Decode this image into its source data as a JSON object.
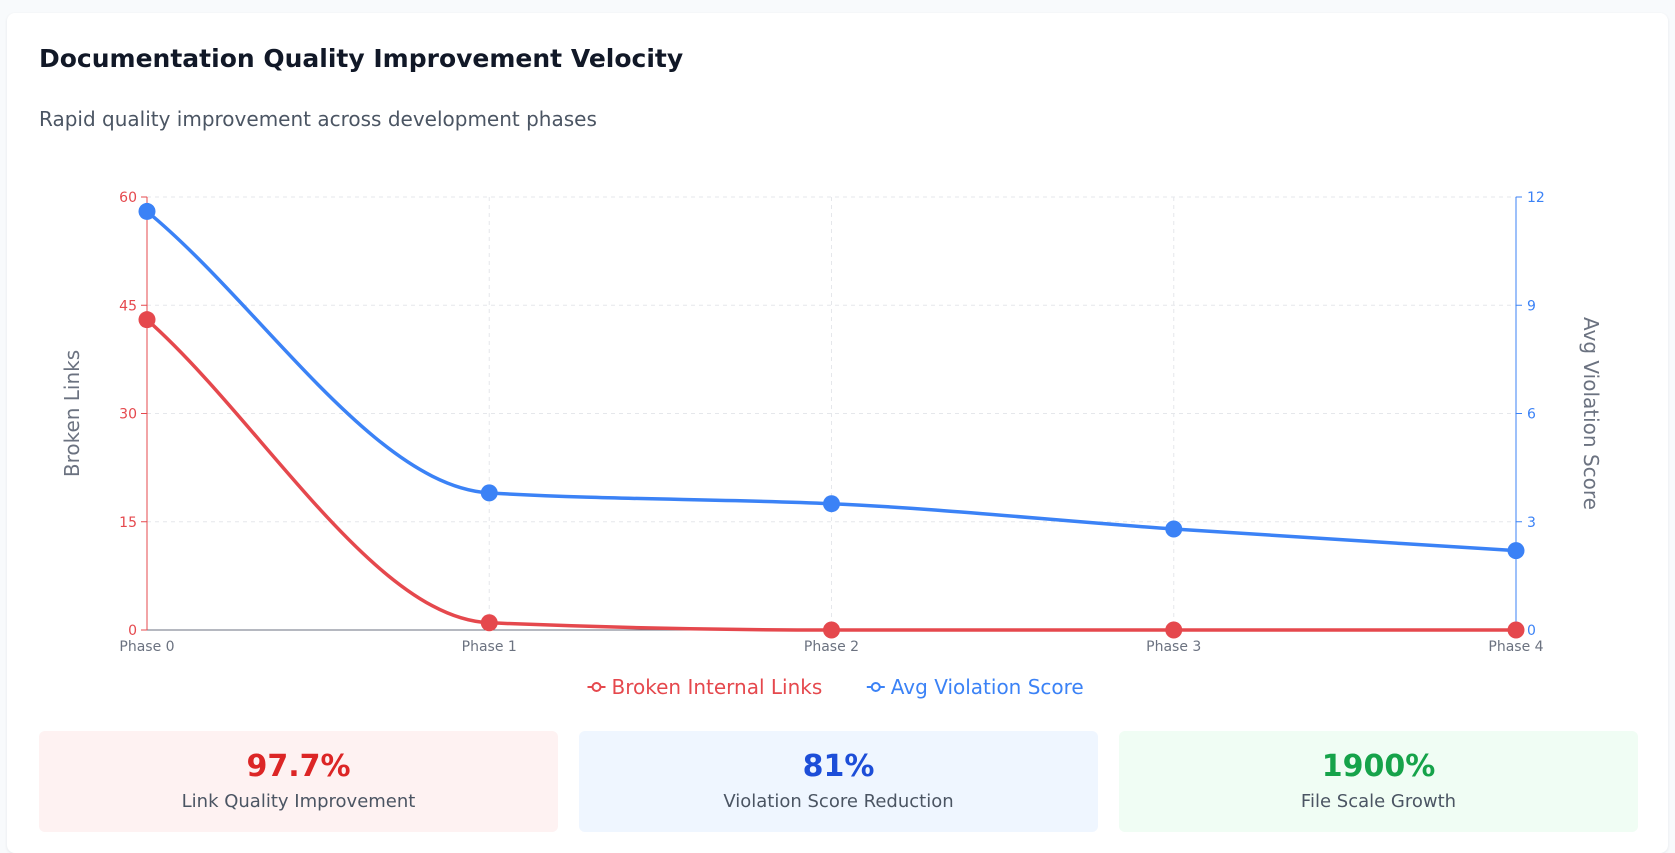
{
  "header": {
    "title": "Documentation Quality Improvement Velocity",
    "subtitle": "Rapid quality improvement across development phases"
  },
  "chart_data": {
    "type": "line",
    "categories": [
      "Phase 0",
      "Phase 1",
      "Phase 2",
      "Phase 3",
      "Phase 4"
    ],
    "series": [
      {
        "name": "Broken Internal Links",
        "axis": "left",
        "color": "#e5484d",
        "values": [
          43,
          1,
          0,
          0,
          0
        ]
      },
      {
        "name": "Avg Violation Score",
        "axis": "right",
        "color": "#3b82f6",
        "values": [
          11.6,
          3.8,
          3.5,
          2.8,
          2.2
        ]
      }
    ],
    "y_left": {
      "label": "Broken Links",
      "range": [
        0,
        60
      ],
      "ticks": [
        0,
        15,
        30,
        45,
        60
      ],
      "color": "#e5484d"
    },
    "y_right": {
      "label": "Avg Violation Score",
      "range": [
        0,
        12
      ],
      "ticks": [
        0,
        3,
        6,
        9,
        12
      ],
      "color": "#3b82f6"
    },
    "grid": true,
    "legend_position": "bottom-center",
    "curve": "smooth"
  },
  "stats": [
    {
      "value": "97.7%",
      "label": "Link Quality Improvement",
      "color": "#dc2626"
    },
    {
      "value": "81%",
      "label": "Violation Score Reduction",
      "color": "#1d4ed8"
    },
    {
      "value": "1900%",
      "label": "File Scale Growth",
      "color": "#16a34a"
    }
  ]
}
